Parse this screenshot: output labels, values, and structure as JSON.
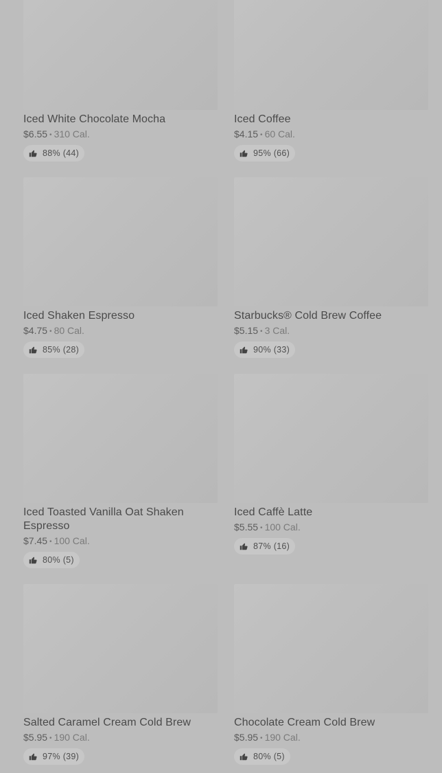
{
  "menu": {
    "items": [
      {
        "name": "Iced White Chocolate Mocha",
        "price": "$6.55",
        "separator": "•",
        "calories": "310 Cal.",
        "rating": "88% (44)"
      },
      {
        "name": "Iced Coffee",
        "price": "$4.15",
        "separator": "•",
        "calories": "60 Cal.",
        "rating": "95% (66)"
      },
      {
        "name": "Iced Shaken Espresso",
        "price": "$4.75",
        "separator": "•",
        "calories": "80 Cal.",
        "rating": "85% (28)"
      },
      {
        "name": "Starbucks® Cold Brew Coffee",
        "price": "$5.15",
        "separator": "•",
        "calories": "3 Cal.",
        "rating": "90% (33)"
      },
      {
        "name": "Iced Toasted Vanilla Oat Shaken Espresso",
        "price": "$7.45",
        "separator": "•",
        "calories": "100 Cal.",
        "rating": "80% (5)"
      },
      {
        "name": "Iced Caffè Latte",
        "price": "$5.55",
        "separator": "•",
        "calories": "100 Cal.",
        "rating": "87% (16)"
      },
      {
        "name": "Salted Caramel Cream Cold Brew",
        "price": "$5.95",
        "separator": "•",
        "calories": "190 Cal.",
        "rating": "97% (39)"
      },
      {
        "name": "Chocolate Cream Cold Brew",
        "price": "$5.95",
        "separator": "•",
        "calories": "190 Cal.",
        "rating": "80% (5)"
      }
    ],
    "rating_icon": "thumbs-up-icon",
    "colors": {
      "overlay": "#bdbdbd",
      "text": "#4a4a4a",
      "muted": "#7a7a7a"
    }
  }
}
